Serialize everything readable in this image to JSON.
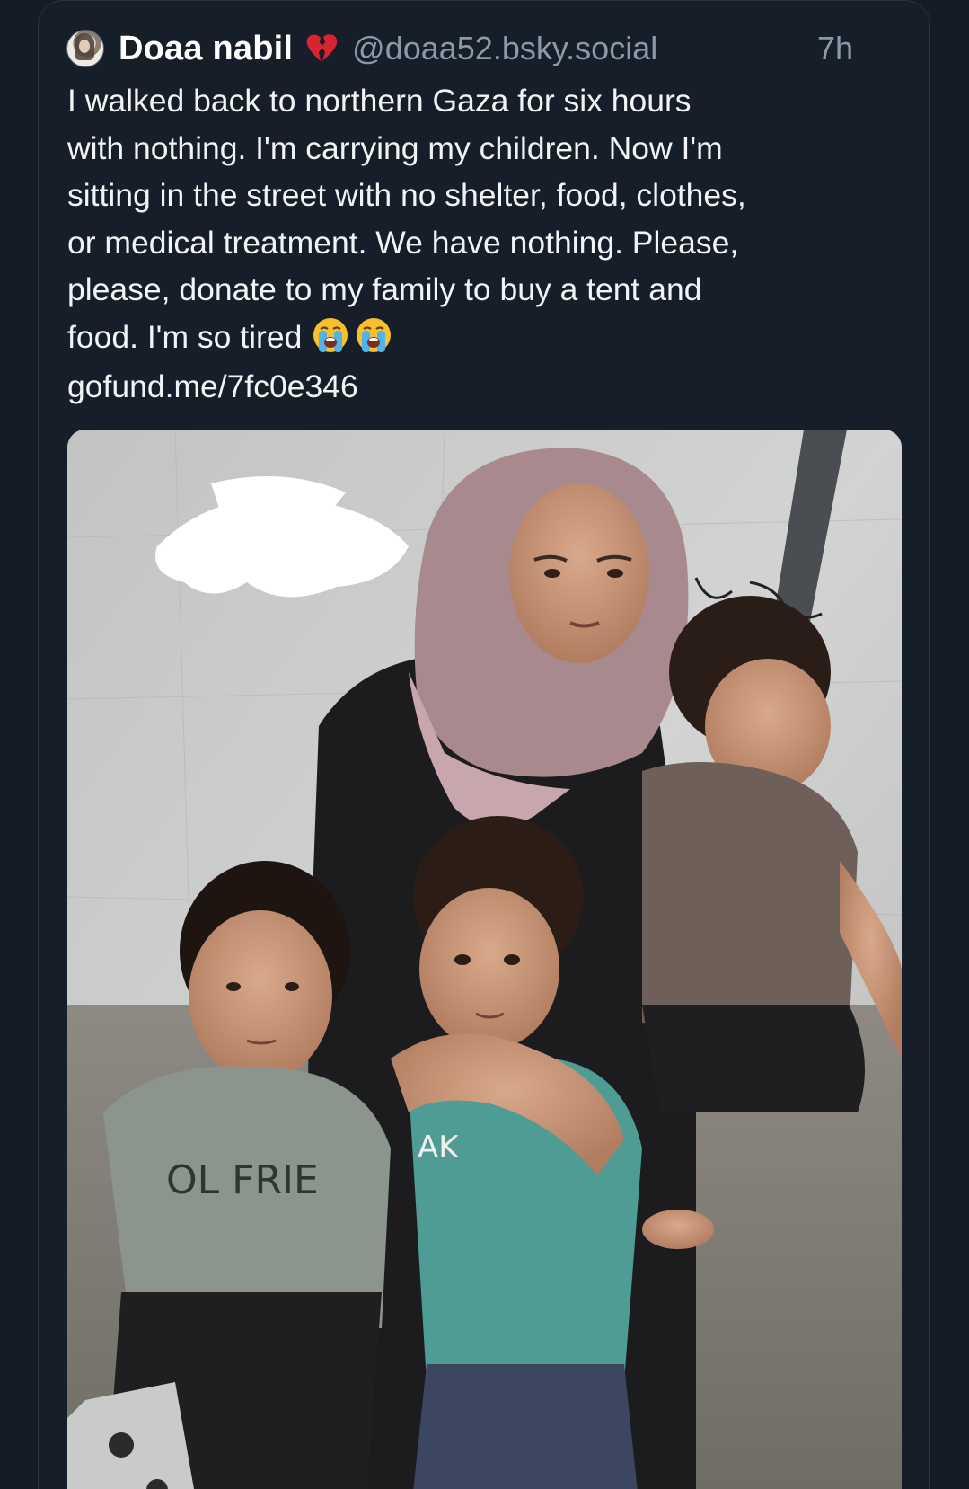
{
  "post": {
    "author": {
      "display_name": "Doaa nabil",
      "name_emoji_icon": "broken-heart-icon",
      "handle": "@doaa52.bsky.social"
    },
    "timestamp": "7h",
    "text": "I walked back to northern Gaza for six hours\nwith nothing. I'm carrying my children. Now I'm\nsitting in the street with no shelter, food, clothes,\nor medical treatment. We have nothing. Please,\nplease, donate to my family to buy a tent and\nfood. I'm so tired",
    "text_emoji_icons": [
      "loudly-crying-face-icon",
      "loudly-crying-face-icon"
    ],
    "link": "gofund.me/7fc0e346",
    "image": {
      "description_icon": "photo-mother-with-three-children"
    }
  },
  "colors": {
    "background": "#151c26",
    "text": "#f1f3f5",
    "muted": "#8d99a7",
    "border": "#2a3340"
  }
}
